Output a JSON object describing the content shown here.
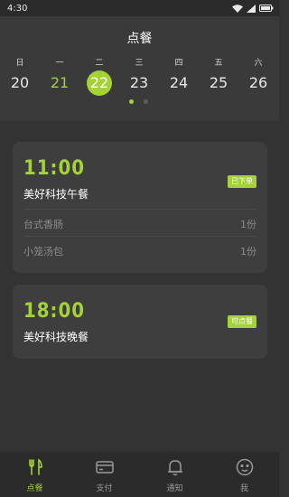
{
  "status_bar": {
    "time": "4:30"
  },
  "header": {
    "title": "点餐"
  },
  "week": {
    "days": [
      {
        "weekday": "日",
        "date": "20",
        "state": "normal"
      },
      {
        "weekday": "一",
        "date": "21",
        "state": "green"
      },
      {
        "weekday": "二",
        "date": "22",
        "state": "selected"
      },
      {
        "weekday": "三",
        "date": "23",
        "state": "normal"
      },
      {
        "weekday": "四",
        "date": "24",
        "state": "normal"
      },
      {
        "weekday": "五",
        "date": "25",
        "state": "normal"
      },
      {
        "weekday": "六",
        "date": "26",
        "state": "normal"
      }
    ],
    "pages": 2,
    "current_page": 1
  },
  "meals": [
    {
      "time": "11:00",
      "name": "美好科技午餐",
      "badge": "已下单",
      "items": [
        {
          "name": "台式香肠",
          "qty": "1份"
        },
        {
          "name": "小笼汤包",
          "qty": "1份"
        }
      ]
    },
    {
      "time": "18:00",
      "name": "美好科技晚餐",
      "badge": "可点餐",
      "items": []
    }
  ],
  "tabs": [
    {
      "label": "点餐",
      "icon": "fork-knife-icon",
      "active": true
    },
    {
      "label": "支付",
      "icon": "card-icon",
      "active": false
    },
    {
      "label": "通知",
      "icon": "bell-icon",
      "active": false
    },
    {
      "label": "我",
      "icon": "smiley-icon",
      "active": false
    }
  ],
  "colors": {
    "accent": "#a4d237",
    "background": "#333333",
    "card": "#3e3e3e",
    "tabbar": "#2b2b2b"
  }
}
